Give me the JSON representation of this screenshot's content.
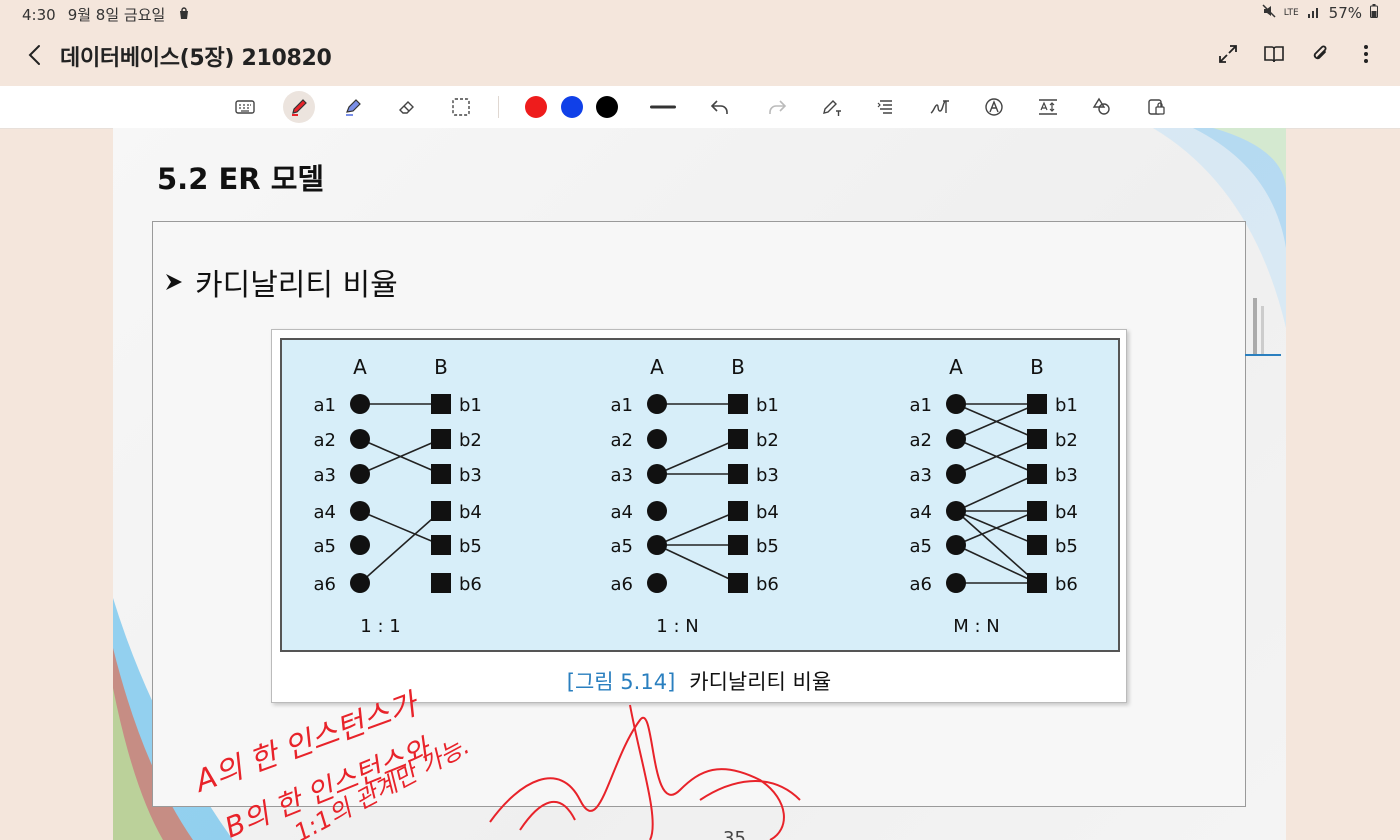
{
  "status": {
    "time": "4:30",
    "date": "9월 8일 금요일",
    "network": "LTE",
    "battery": "57%"
  },
  "title": "데이터베이스(5장) 210820",
  "colors": {
    "pen_red": "#ee1c1c",
    "pen_blue": "#1040e8",
    "pen_black": "#000000",
    "ink": "#e8232a"
  },
  "slide": {
    "heading": "5.2 ER 모델",
    "bullet_title": "카디날리티 비율",
    "figure_caption_num": "[그림 5.14]",
    "figure_caption_text": "카디날리티 비율",
    "page_number": "35"
  },
  "diagrams": [
    {
      "label": "1 : 1",
      "left_set": "A",
      "right_set": "B",
      "left": [
        "a1",
        "a2",
        "a3",
        "a4",
        "a5",
        "a6"
      ],
      "right": [
        "b1",
        "b2",
        "b3",
        "b4",
        "b5",
        "b6"
      ],
      "links": [
        [
          0,
          0
        ],
        [
          1,
          2
        ],
        [
          2,
          1
        ],
        [
          3,
          4
        ],
        [
          5,
          3
        ]
      ]
    },
    {
      "label": "1 : N",
      "left_set": "A",
      "right_set": "B",
      "left": [
        "a1",
        "a2",
        "a3",
        "a4",
        "a5",
        "a6"
      ],
      "right": [
        "b1",
        "b2",
        "b3",
        "b4",
        "b5",
        "b6"
      ],
      "links": [
        [
          0,
          0
        ],
        [
          2,
          1
        ],
        [
          2,
          2
        ],
        [
          4,
          3
        ],
        [
          4,
          4
        ],
        [
          4,
          5
        ]
      ]
    },
    {
      "label": "M : N",
      "left_set": "A",
      "right_set": "B",
      "left": [
        "a1",
        "a2",
        "a3",
        "a4",
        "a5",
        "a6"
      ],
      "right": [
        "b1",
        "b2",
        "b3",
        "b4",
        "b5",
        "b6"
      ],
      "links": [
        [
          0,
          0
        ],
        [
          0,
          1
        ],
        [
          1,
          0
        ],
        [
          1,
          2
        ],
        [
          2,
          1
        ],
        [
          3,
          2
        ],
        [
          3,
          3
        ],
        [
          3,
          4
        ],
        [
          3,
          5
        ],
        [
          4,
          3
        ],
        [
          4,
          5
        ],
        [
          5,
          5
        ]
      ]
    }
  ],
  "handwriting": {
    "line1": "A의 한 인스턴스가",
    "line2": "B의 한 인스턴스와",
    "line3": "1:1의 관계만 가능."
  }
}
